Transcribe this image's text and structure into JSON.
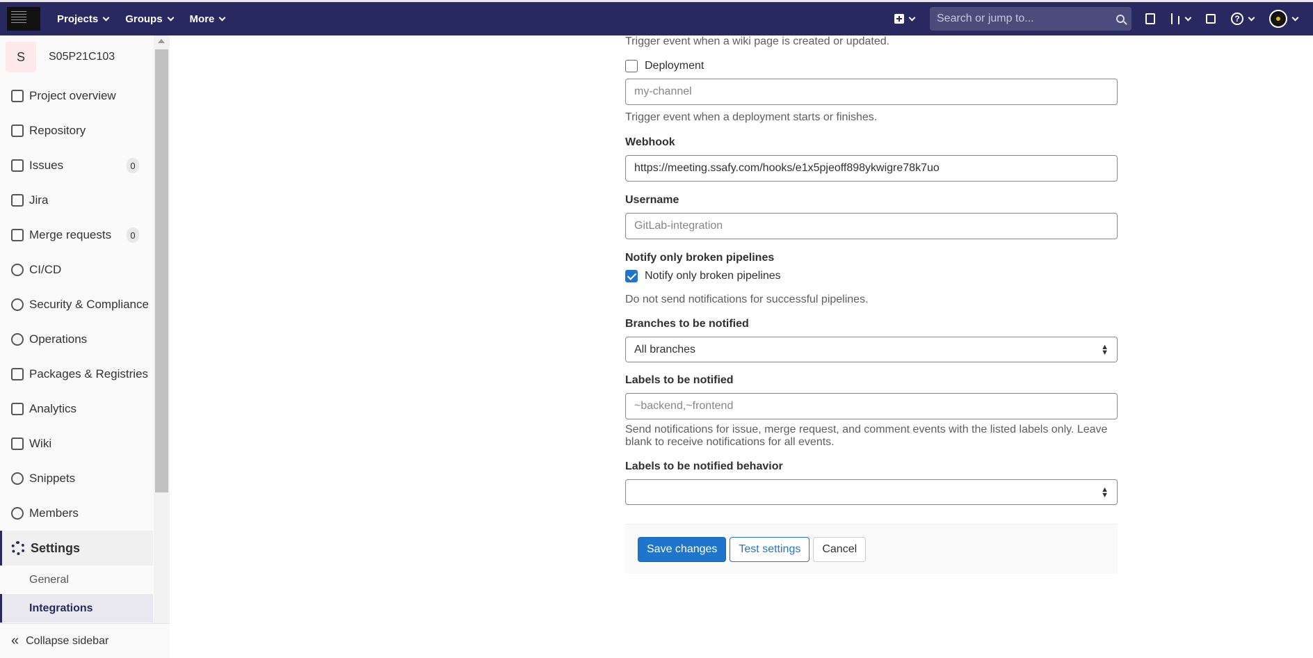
{
  "nav": {
    "projects": "Projects",
    "groups": "Groups",
    "more": "More",
    "search_placeholder": "Search or jump to..."
  },
  "sidebar": {
    "project_initial": "S",
    "project_name": "S05P21C103",
    "items": [
      {
        "label": "Project overview",
        "icon": "home-icon"
      },
      {
        "label": "Repository",
        "icon": "document-icon"
      },
      {
        "label": "Issues",
        "icon": "issues-icon",
        "badge": "0"
      },
      {
        "label": "Jira",
        "icon": "external-link-icon"
      },
      {
        "label": "Merge requests",
        "icon": "merge-request-icon",
        "badge": "0"
      },
      {
        "label": "CI/CD",
        "icon": "rocket-icon"
      },
      {
        "label": "Security & Compliance",
        "icon": "shield-icon"
      },
      {
        "label": "Operations",
        "icon": "cloud-icon"
      },
      {
        "label": "Packages & Registries",
        "icon": "package-icon"
      },
      {
        "label": "Analytics",
        "icon": "chart-icon"
      },
      {
        "label": "Wiki",
        "icon": "book-icon"
      },
      {
        "label": "Snippets",
        "icon": "scissors-icon"
      },
      {
        "label": "Members",
        "icon": "users-icon"
      }
    ],
    "settings": "Settings",
    "sub_general": "General",
    "sub_integrations": "Integrations",
    "collapse": "Collapse sidebar"
  },
  "form": {
    "wiki_help": "Trigger event when a wiki page is created or updated.",
    "deployment_label": "Deployment",
    "deployment_placeholder": "my-channel",
    "deployment_help": "Trigger event when a deployment starts or finishes.",
    "webhook_label": "Webhook",
    "webhook_value": "https://meeting.ssafy.com/hooks/e1x5pjeoff898ykwigre78k7uo",
    "username_label": "Username",
    "username_placeholder": "GitLab-integration",
    "broken_label": "Notify only broken pipelines",
    "broken_checkbox": "Notify only broken pipelines",
    "broken_help": "Do not send notifications for successful pipelines.",
    "branches_label": "Branches to be notified",
    "branches_value": "All branches",
    "labels_label": "Labels to be notified",
    "labels_placeholder": "~backend,~frontend",
    "labels_help": "Send notifications for issue, merge request, and comment events with the listed labels only. Leave blank to receive notifications for all events.",
    "behavior_label": "Labels to be notified behavior",
    "behavior_value": "",
    "save": "Save changes",
    "test": "Test settings",
    "cancel": "Cancel"
  }
}
